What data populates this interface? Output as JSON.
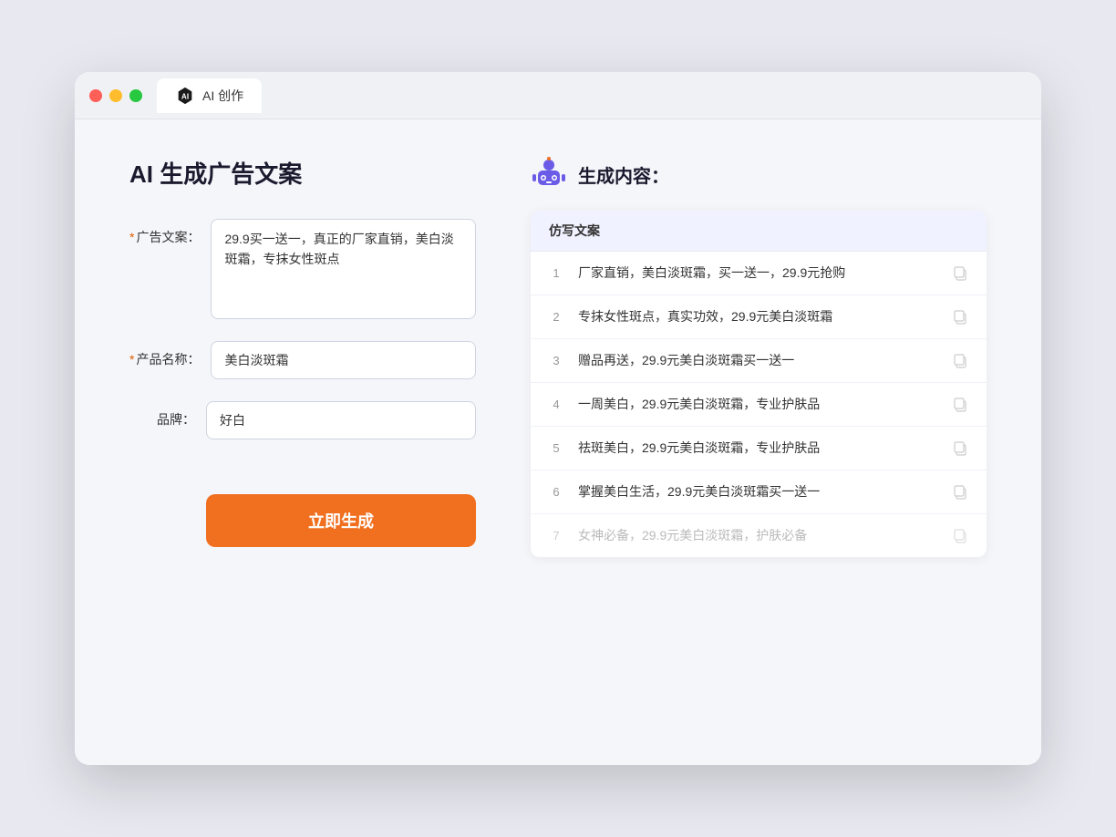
{
  "browser": {
    "tab_label": "AI 创作"
  },
  "page": {
    "title": "AI 生成广告文案"
  },
  "form": {
    "ad_copy_label": "广告文案：",
    "ad_copy_required": "*",
    "ad_copy_value": "29.9买一送一，真正的厂家直销，美白淡斑霜，专抹女性斑点",
    "product_name_label": "产品名称：",
    "product_name_required": "*",
    "product_name_value": "美白淡斑霜",
    "brand_label": "品牌：",
    "brand_value": "好白",
    "generate_btn": "立即生成"
  },
  "result": {
    "header": "生成内容：",
    "table_col": "仿写文案",
    "rows": [
      {
        "num": "1",
        "text": "厂家直销，美白淡斑霜，买一送一，29.9元抢购",
        "faded": false
      },
      {
        "num": "2",
        "text": "专抹女性斑点，真实功效，29.9元美白淡斑霜",
        "faded": false
      },
      {
        "num": "3",
        "text": "赠品再送，29.9元美白淡斑霜买一送一",
        "faded": false
      },
      {
        "num": "4",
        "text": "一周美白，29.9元美白淡斑霜，专业护肤品",
        "faded": false
      },
      {
        "num": "5",
        "text": "祛斑美白，29.9元美白淡斑霜，专业护肤品",
        "faded": false
      },
      {
        "num": "6",
        "text": "掌握美白生活，29.9元美白淡斑霜买一送一",
        "faded": false
      },
      {
        "num": "7",
        "text": "女神必备，29.9元美白淡斑霜，护肤必备",
        "faded": true
      }
    ]
  }
}
